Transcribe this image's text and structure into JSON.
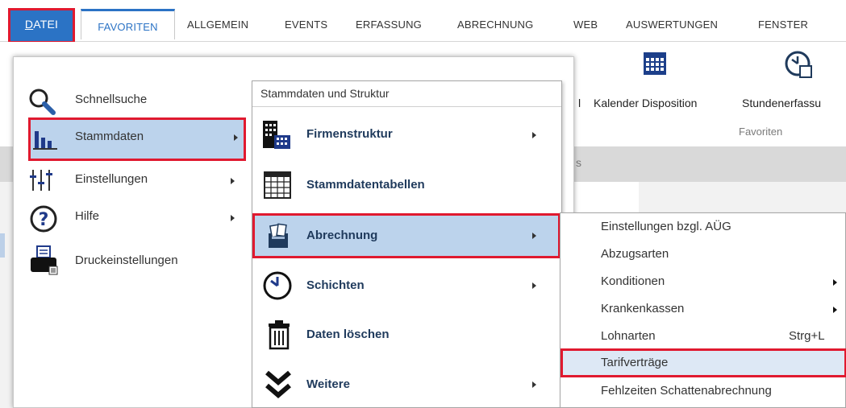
{
  "ribbon": {
    "tabs": [
      "DATEI",
      "FAVORITEN",
      "ALLGEMEIN",
      "EVENTS",
      "ERFASSUNG",
      "ABRECHNUNG",
      "WEB",
      "AUSWERTUNGEN",
      "FENSTER"
    ],
    "datei_first": "D",
    "datei_rest": "ATEI",
    "items": [
      "l",
      "Kalender Disposition",
      "Stundenerfassu"
    ],
    "group_label": "Favoriten",
    "gray_fragment": "s"
  },
  "file_menu": {
    "items": [
      {
        "label": "Schnellsuche",
        "icon": "magnifier-icon",
        "has_submenu": false
      },
      {
        "label": "Stammdaten",
        "icon": "bar-chart-icon",
        "has_submenu": true
      },
      {
        "label": "Einstellungen",
        "icon": "sliders-icon",
        "has_submenu": true
      },
      {
        "label": "Hilfe",
        "icon": "help-icon",
        "has_submenu": true
      },
      {
        "label": "Druckeinstellungen",
        "icon": "printer-icon",
        "has_submenu": false
      }
    ]
  },
  "stammdaten_menu": {
    "title": "Stammdaten und Struktur",
    "items": [
      {
        "label": "Firmenstruktur",
        "icon": "buildings-icon",
        "has_submenu": true
      },
      {
        "label": "Stammdatentabellen",
        "icon": "table-grid-icon",
        "has_submenu": false
      },
      {
        "label": "Abrechnung",
        "icon": "billing-box-icon",
        "has_submenu": true
      },
      {
        "label": "Schichten",
        "icon": "clock-icon",
        "has_submenu": true
      },
      {
        "label": "Daten löschen",
        "icon": "trash-icon",
        "has_submenu": false
      },
      {
        "label": "Weitere",
        "icon": "double-chevron-down-icon",
        "has_submenu": true
      }
    ]
  },
  "abrechnung_menu": {
    "items": [
      {
        "label": "Einstellungen bzgl. AÜG",
        "shortcut": "",
        "has_submenu": false
      },
      {
        "label": "Abzugsarten",
        "shortcut": "",
        "has_submenu": false
      },
      {
        "label": "Konditionen",
        "shortcut": "",
        "has_submenu": true
      },
      {
        "label": "Krankenkassen",
        "shortcut": "",
        "has_submenu": true
      },
      {
        "label": "Lohnarten",
        "shortcut": "Strg+L",
        "has_submenu": false
      },
      {
        "label": "Tarifverträge",
        "shortcut": "",
        "has_submenu": false
      },
      {
        "label": "Fehlzeiten Schattenabrechnung",
        "shortcut": "",
        "has_submenu": false
      }
    ]
  },
  "colors": {
    "accent_blue": "#2b73c5",
    "highlight_bg": "#bcd3ec",
    "annotation_red": "#e0192f"
  }
}
